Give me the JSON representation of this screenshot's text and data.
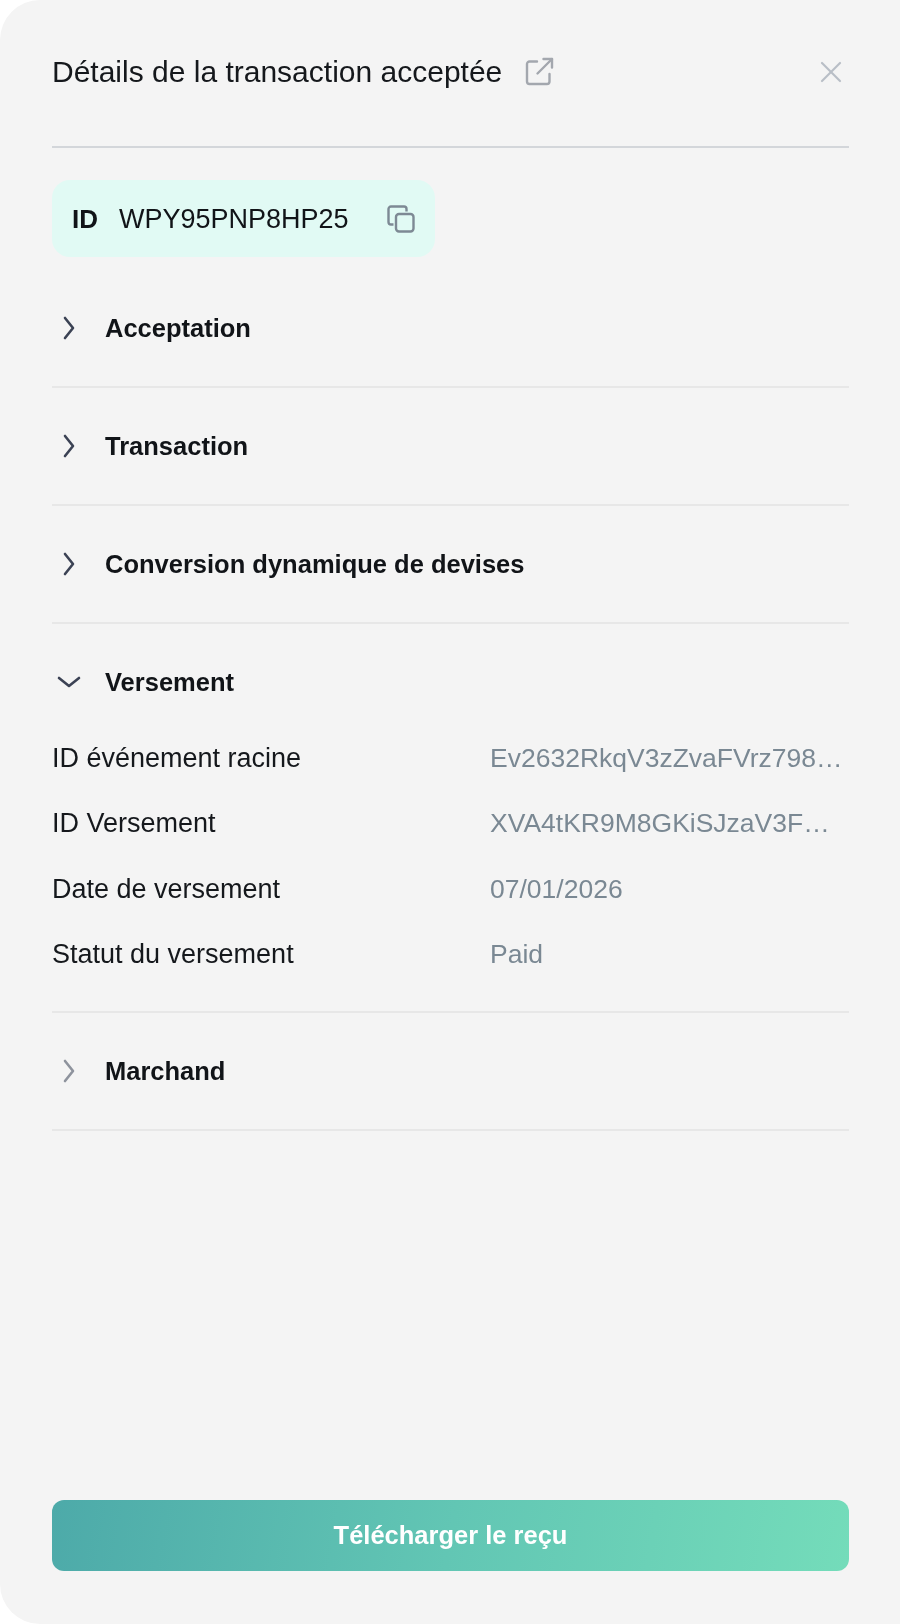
{
  "panel": {
    "title": "Détails de la transaction acceptée",
    "id_badge": {
      "label": "ID",
      "value": "WPY95PNP8HP25"
    },
    "sections": [
      {
        "title": "Acceptation",
        "expanded": false,
        "dimmed": false
      },
      {
        "title": "Transaction",
        "expanded": false,
        "dimmed": false
      },
      {
        "title": "Conversion dynamique de devises",
        "expanded": false,
        "dimmed": false
      },
      {
        "title": "Versement",
        "expanded": true,
        "dimmed": false,
        "rows": [
          {
            "label": "ID événement racine",
            "value": "Ev2632RkqV3zZvaFVrz798…"
          },
          {
            "label": "ID Versement",
            "value": "XVA4tKR9M8GKiSJzaV3F…"
          },
          {
            "label": "Date de versement",
            "value": "07/01/2026"
          },
          {
            "label": "Statut du versement",
            "value": "Paid"
          }
        ]
      },
      {
        "title": "Marchand",
        "expanded": false,
        "dimmed": true
      }
    ],
    "download_button": {
      "label": "Télécharger le reçu"
    }
  }
}
